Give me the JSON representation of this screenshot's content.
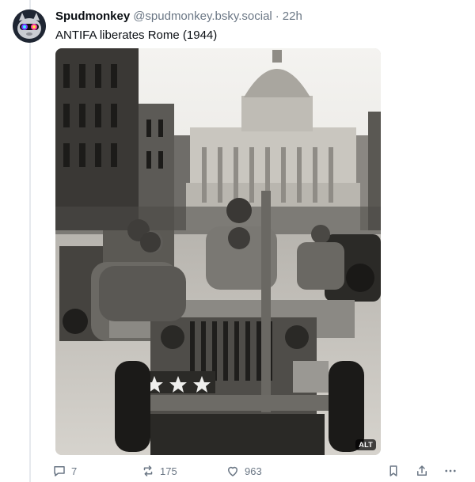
{
  "post": {
    "display_name": "Spudmonkey",
    "handle": "@spudmonkey.bsky.social",
    "separator": "·",
    "time": "22h",
    "text": "ANTIFA liberates Rome (1944)",
    "image_alt_badge": "ALT"
  },
  "actions": {
    "reply_count": "7",
    "repost_count": "175",
    "like_count": "963"
  },
  "icons": {
    "reply": "reply-icon",
    "repost": "repost-icon",
    "like": "heart-icon",
    "bookmark": "bookmark-icon",
    "share": "share-icon",
    "more": "more-icon"
  },
  "colors": {
    "muted": "#6b7785",
    "text": "#0b0f14"
  }
}
